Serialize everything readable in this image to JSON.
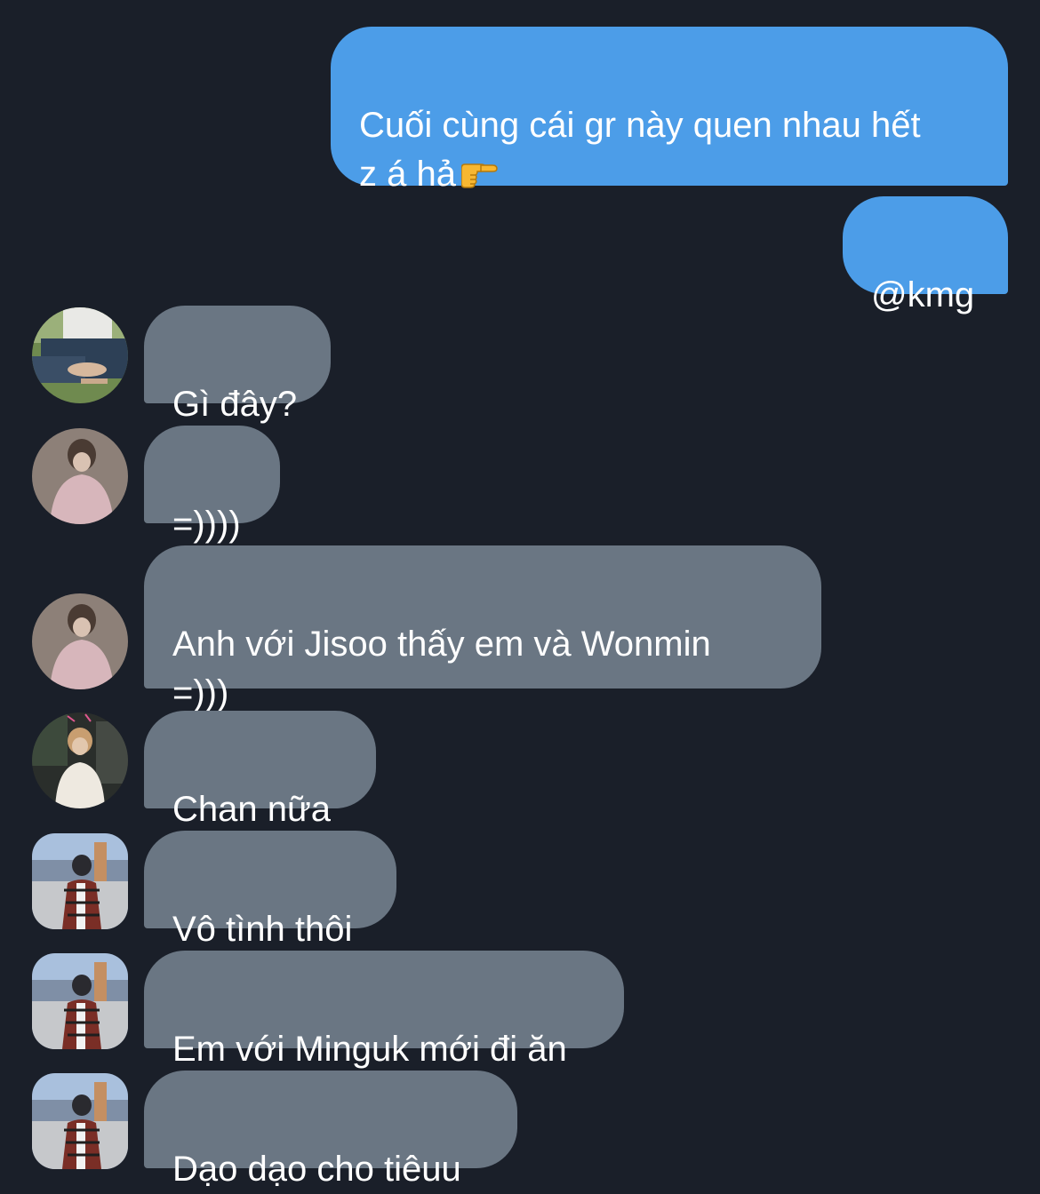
{
  "messages": [
    {
      "side": "sent",
      "text": "Cuối cùng cái gr này quen nhau hết\nz á hả",
      "emoji": "backhand-index-pointing-right-icon"
    },
    {
      "side": "sent",
      "text": "@kmg"
    },
    {
      "side": "received",
      "avatar": "avatar-man-sitting",
      "text": "Gì đây?"
    },
    {
      "side": "received",
      "avatar": "avatar-woman-pink-sweater",
      "text": "=))))"
    },
    {
      "side": "received",
      "avatar": "avatar-woman-pink-sweater",
      "text": "Anh với Jisoo thấy em và Wonmin\n=)))"
    },
    {
      "side": "received",
      "avatar": "avatar-man-white-jacket",
      "text": "Chan nữa"
    },
    {
      "side": "received",
      "avatar": "avatar-man-plaid-shirt",
      "text": "Vô tình thôi"
    },
    {
      "side": "received",
      "avatar": "avatar-man-plaid-shirt",
      "text": "Em với Minguk mới đi ăn"
    },
    {
      "side": "received",
      "avatar": "avatar-man-plaid-shirt",
      "text": "Dạo dạo cho tiêuu"
    }
  ],
  "colors": {
    "background": "#1a1f29",
    "sent_bubble": "#4c9de8",
    "received_bubble": "#6a7683",
    "text": "#ffffff"
  }
}
